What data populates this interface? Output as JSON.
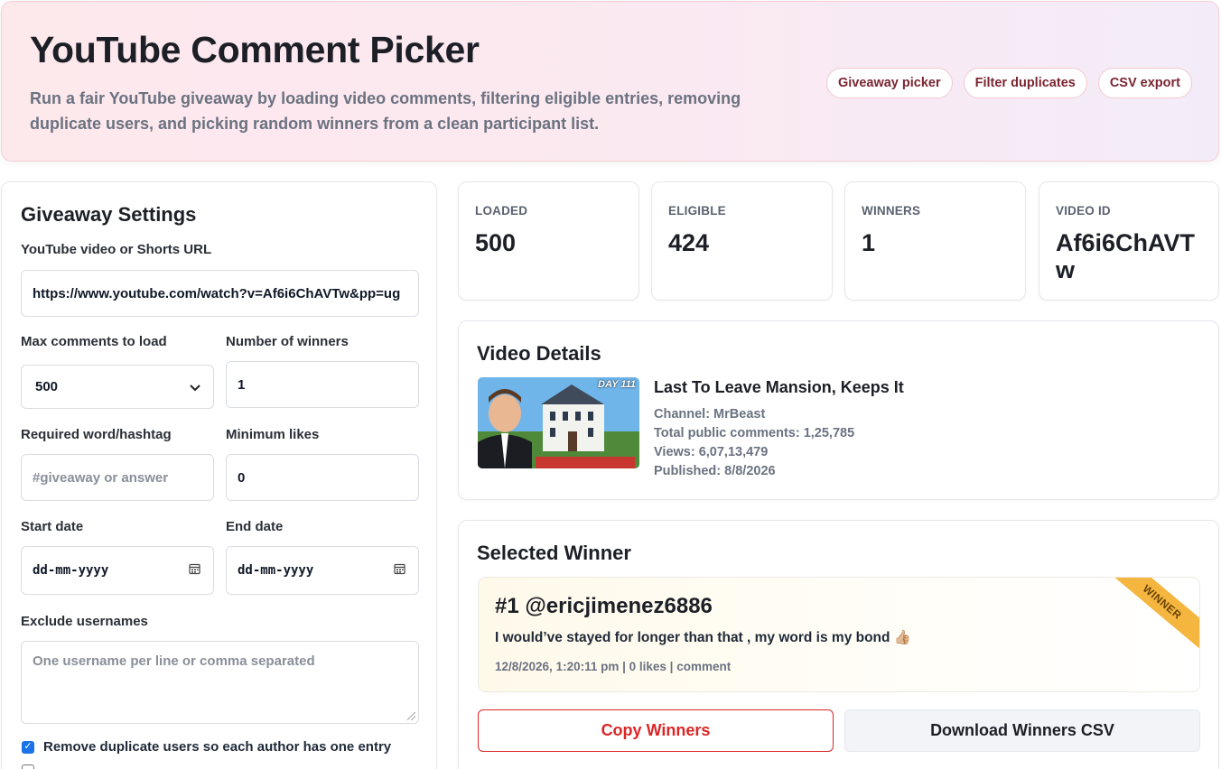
{
  "header": {
    "title": "YouTube Comment Picker",
    "subtitle": "Run a fair YouTube giveaway by loading video comments, filtering eligible entries, removing duplicate users, and picking random winners from a clean participant list.",
    "pills": [
      "Giveaway picker",
      "Filter duplicates",
      "CSV export"
    ]
  },
  "settings": {
    "title": "Giveaway Settings",
    "url_label": "YouTube video or Shorts URL",
    "url_value": "https://www.youtube.com/watch?v=Af6i6ChAVTw&pp=ug",
    "max_label": "Max comments to load",
    "max_value": "500",
    "winners_label": "Number of winners",
    "winners_value": "1",
    "word_label": "Required word/hashtag",
    "word_placeholder": "#giveaway or answer",
    "likes_label": "Minimum likes",
    "likes_value": "0",
    "start_label": "Start date",
    "start_value": "dd-mm-yyyy",
    "end_label": "End date",
    "end_value": "dd-mm-yyyy",
    "exclude_label": "Exclude usernames",
    "exclude_placeholder": "One username per line or comma separated",
    "dedupe_label": "Remove duplicate users so each author has one entry",
    "dedupe_checked": true
  },
  "stats": [
    {
      "key": "LOADED",
      "value": "500"
    },
    {
      "key": "ELIGIBLE",
      "value": "424"
    },
    {
      "key": "WINNERS",
      "value": "1"
    },
    {
      "key": "VIDEO ID",
      "value": "Af6i6ChAVTw"
    }
  ],
  "video": {
    "section_title": "Video Details",
    "title": "Last To Leave Mansion, Keeps It",
    "channel": "Channel: MrBeast",
    "comments": "Total public comments: 1,25,785",
    "views": "Views: 6,07,13,479",
    "published": "Published: 8/8/2026",
    "thumb_badge": "DAY 111"
  },
  "winner": {
    "section_title": "Selected Winner",
    "name": "#1 @ericjimenez6886",
    "comment": "I would’ve stayed for longer than that , my word is my bond 👍🏼",
    "meta": "12/8/2026, 1:20:11 pm | 0 likes | comment",
    "ribbon": "WINNER",
    "copy_label": "Copy Winners",
    "download_label": "Download Winners CSV"
  },
  "colors": {
    "accent_red": "#dc2626",
    "ribbon": "#f4b63f",
    "checkbox": "#1a73e8"
  }
}
